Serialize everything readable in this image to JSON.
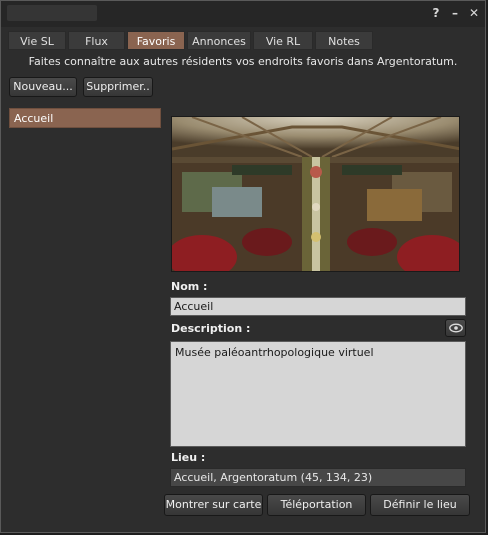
{
  "window": {
    "controls": [
      "?",
      "–",
      "✕"
    ]
  },
  "tabs": [
    {
      "label": "Vie SL",
      "active": false
    },
    {
      "label": "Flux",
      "active": false
    },
    {
      "label": "Favoris",
      "active": true
    },
    {
      "label": "Annonces",
      "active": false
    },
    {
      "label": "Vie RL",
      "active": false
    },
    {
      "label": "Notes",
      "active": false
    }
  ],
  "intro_text": "Faites connaître aux autres résidents vos endroits favoris dans Argentoratum.",
  "toolbar": {
    "new_label": "Nouveau...",
    "delete_label": "Supprimer.."
  },
  "picks_list": [
    {
      "label": "Accueil",
      "selected": true
    }
  ],
  "detail": {
    "name_label": "Nom :",
    "name_value": "Accueil",
    "description_label": "Description :",
    "description_value": "Musée paléoantrhopologique virtuel",
    "location_label": "Lieu :",
    "location_value": "Accueil, Argentoratum  (45, 134, 23)"
  },
  "actions": {
    "show_on_map_label": "Montrer sur carte",
    "teleport_label": "Téléportation",
    "set_location_label": "Définir le lieu"
  },
  "colors": {
    "accent": "#8a6450",
    "window_bg": "#2d2d2d",
    "field_bg": "#d6d6d6"
  },
  "icons": {
    "visibility_toggle": "eye-icon"
  }
}
